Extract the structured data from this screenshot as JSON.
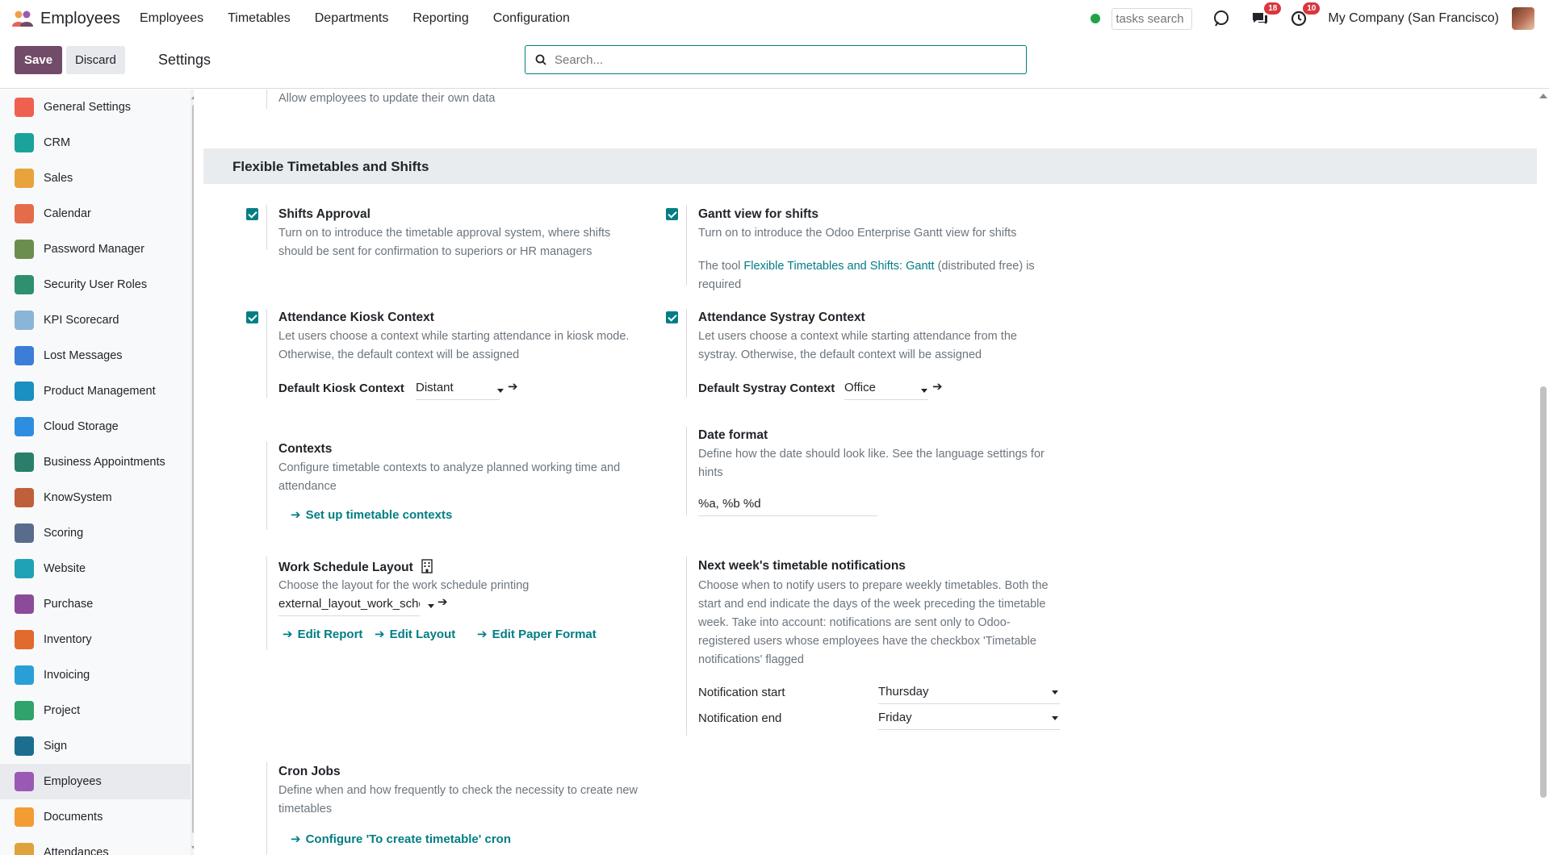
{
  "navbar": {
    "app_name": "Employees",
    "menu": [
      "Employees",
      "Timetables",
      "Departments",
      "Reporting",
      "Configuration"
    ],
    "tasks_search_placeholder": "tasks search",
    "messages_badge": "18",
    "activities_badge": "10",
    "company": "My Company (San Francisco)"
  },
  "control_panel": {
    "save_label": "Save",
    "discard_label": "Discard",
    "title": "Settings",
    "search_placeholder": "Search..."
  },
  "sidebar": {
    "items": [
      {
        "label": "General Settings",
        "color": "#f06050"
      },
      {
        "label": "CRM",
        "color": "#1aa39a"
      },
      {
        "label": "Sales",
        "color": "#e8a33d"
      },
      {
        "label": "Calendar",
        "color": "#e46c4a"
      },
      {
        "label": "Password Manager",
        "color": "#6b8e4e"
      },
      {
        "label": "Security User Roles",
        "color": "#2f8f6f"
      },
      {
        "label": "KPI Scorecard",
        "color": "#8ab4d8"
      },
      {
        "label": "Lost Messages",
        "color": "#3b7dd8"
      },
      {
        "label": "Product Management",
        "color": "#1a8fc2"
      },
      {
        "label": "Cloud Storage",
        "color": "#2d8de0"
      },
      {
        "label": "Business Appointments",
        "color": "#2a7f6b"
      },
      {
        "label": "KnowSystem",
        "color": "#c0603a"
      },
      {
        "label": "Scoring",
        "color": "#5a6c8c"
      },
      {
        "label": "Website",
        "color": "#1fa2b6"
      },
      {
        "label": "Purchase",
        "color": "#8a4b9a"
      },
      {
        "label": "Inventory",
        "color": "#e26a2c"
      },
      {
        "label": "Invoicing",
        "color": "#2a9fd6"
      },
      {
        "label": "Project",
        "color": "#2fa36b"
      },
      {
        "label": "Sign",
        "color": "#1c6e8e"
      },
      {
        "label": "Employees",
        "color": "#9b59b6"
      },
      {
        "label": "Documents",
        "color": "#f39c34"
      },
      {
        "label": "Attendances",
        "color": "#e0a23a"
      }
    ],
    "active_index": 19
  },
  "main": {
    "intro_text": "Allow employees to update their own data",
    "section_title": "Flexible Timetables and Shifts",
    "shifts_approval": {
      "title": "Shifts Approval",
      "desc": "Turn on to introduce the timetable approval system, where shifts should be sent for confirmation to superiors or HR managers"
    },
    "gantt": {
      "title": "Gantt view for shifts",
      "desc": "Turn on to introduce the Odoo Enterprise Gantt view for shifts",
      "tool_prefix": "The tool ",
      "tool_link": "Flexible Timetables and Shifts: Gantt",
      "tool_suffix": " (distributed free) is required"
    },
    "kiosk": {
      "title": "Attendance Kiosk Context",
      "desc": "Let users choose a context while starting attendance in kiosk mode. Otherwise, the default context will be assigned",
      "field_label": "Default Kiosk Context",
      "field_value": "Distant"
    },
    "systray": {
      "title": "Attendance Systray Context",
      "desc": "Let users choose a context while starting attendance from the systray. Otherwise, the default context will be assigned",
      "field_label": "Default Systray Context",
      "field_value": "Office"
    },
    "contexts": {
      "title": "Contexts",
      "desc": "Configure timetable contexts to analyze planned working time and attendance",
      "link": "Set up timetable contexts"
    },
    "date_format": {
      "title": "Date format",
      "desc": "Define how the date should look like. See the language settings for hints",
      "value": "%a, %b %d"
    },
    "work_schedule": {
      "title": "Work Schedule Layout",
      "desc": "Choose the layout for the work schedule printing",
      "value": "external_layout_work_sche",
      "links": [
        "Edit Report",
        "Edit Layout",
        "Edit Paper Format"
      ]
    },
    "notifications": {
      "title": "Next week's timetable notifications",
      "desc": "Choose when to notify users to prepare weekly timetables. Both the start and end indicate the days of the week preceding the timetable week. Take into account: notifications are sent only to Odoo-registered users whose employees have the checkbox 'Timetable notifications' flagged",
      "start_label": "Notification start",
      "start_value": "Thursday",
      "end_label": "Notification end",
      "end_value": "Friday"
    },
    "cron": {
      "title": "Cron Jobs",
      "desc": "Define when and how frequently to check the necessity to create new timetables",
      "link": "Configure 'To create timetable' cron"
    }
  }
}
